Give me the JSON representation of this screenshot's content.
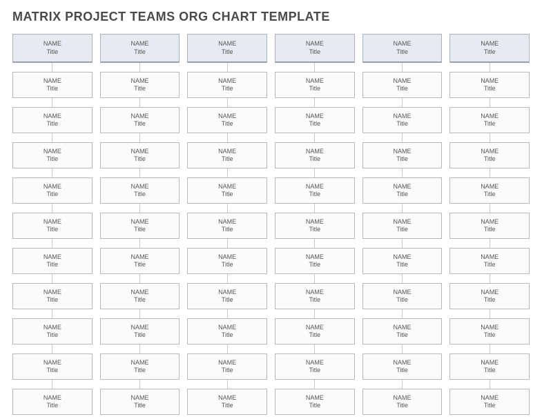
{
  "title": "MATRIX PROJECT TEAMS ORG CHART TEMPLATE",
  "default_name": "NAME",
  "default_title": "Title",
  "columns": 6,
  "rows_per_column": 11,
  "nodes": [
    [
      {
        "name": "NAME",
        "title": "Title"
      },
      {
        "name": "NAME",
        "title": "Title"
      },
      {
        "name": "NAME",
        "title": "Title"
      },
      {
        "name": "NAME",
        "title": "Title"
      },
      {
        "name": "NAME",
        "title": "Title"
      },
      {
        "name": "NAME",
        "title": "Title"
      },
      {
        "name": "NAME",
        "title": "Title"
      },
      {
        "name": "NAME",
        "title": "Title"
      },
      {
        "name": "NAME",
        "title": "Title"
      },
      {
        "name": "NAME",
        "title": "Title"
      },
      {
        "name": "NAME",
        "title": "Title"
      }
    ],
    [
      {
        "name": "NAME",
        "title": "Title"
      },
      {
        "name": "NAME",
        "title": "Title"
      },
      {
        "name": "NAME",
        "title": "Title"
      },
      {
        "name": "NAME",
        "title": "Title"
      },
      {
        "name": "NAME",
        "title": "Title"
      },
      {
        "name": "NAME",
        "title": "Title"
      },
      {
        "name": "NAME",
        "title": "Title"
      },
      {
        "name": "NAME",
        "title": "Title"
      },
      {
        "name": "NAME",
        "title": "Title"
      },
      {
        "name": "NAME",
        "title": "Title"
      },
      {
        "name": "NAME",
        "title": "Title"
      }
    ],
    [
      {
        "name": "NAME",
        "title": "Title"
      },
      {
        "name": "NAME",
        "title": "Title"
      },
      {
        "name": "NAME",
        "title": "Title"
      },
      {
        "name": "NAME",
        "title": "Title"
      },
      {
        "name": "NAME",
        "title": "Title"
      },
      {
        "name": "NAME",
        "title": "Title"
      },
      {
        "name": "NAME",
        "title": "Title"
      },
      {
        "name": "NAME",
        "title": "Title"
      },
      {
        "name": "NAME",
        "title": "Title"
      },
      {
        "name": "NAME",
        "title": "Title"
      },
      {
        "name": "NAME",
        "title": "Title"
      }
    ],
    [
      {
        "name": "NAME",
        "title": "Title"
      },
      {
        "name": "NAME",
        "title": "Title"
      },
      {
        "name": "NAME",
        "title": "Title"
      },
      {
        "name": "NAME",
        "title": "Title"
      },
      {
        "name": "NAME",
        "title": "Title"
      },
      {
        "name": "NAME",
        "title": "Title"
      },
      {
        "name": "NAME",
        "title": "Title"
      },
      {
        "name": "NAME",
        "title": "Title"
      },
      {
        "name": "NAME",
        "title": "Title"
      },
      {
        "name": "NAME",
        "title": "Title"
      },
      {
        "name": "NAME",
        "title": "Title"
      }
    ],
    [
      {
        "name": "NAME",
        "title": "Title"
      },
      {
        "name": "NAME",
        "title": "Title"
      },
      {
        "name": "NAME",
        "title": "Title"
      },
      {
        "name": "NAME",
        "title": "Title"
      },
      {
        "name": "NAME",
        "title": "Title"
      },
      {
        "name": "NAME",
        "title": "Title"
      },
      {
        "name": "NAME",
        "title": "Title"
      },
      {
        "name": "NAME",
        "title": "Title"
      },
      {
        "name": "NAME",
        "title": "Title"
      },
      {
        "name": "NAME",
        "title": "Title"
      },
      {
        "name": "NAME",
        "title": "Title"
      }
    ],
    [
      {
        "name": "NAME",
        "title": "Title"
      },
      {
        "name": "NAME",
        "title": "Title"
      },
      {
        "name": "NAME",
        "title": "Title"
      },
      {
        "name": "NAME",
        "title": "Title"
      },
      {
        "name": "NAME",
        "title": "Title"
      },
      {
        "name": "NAME",
        "title": "Title"
      },
      {
        "name": "NAME",
        "title": "Title"
      },
      {
        "name": "NAME",
        "title": "Title"
      },
      {
        "name": "NAME",
        "title": "Title"
      },
      {
        "name": "NAME",
        "title": "Title"
      },
      {
        "name": "NAME",
        "title": "Title"
      }
    ]
  ]
}
